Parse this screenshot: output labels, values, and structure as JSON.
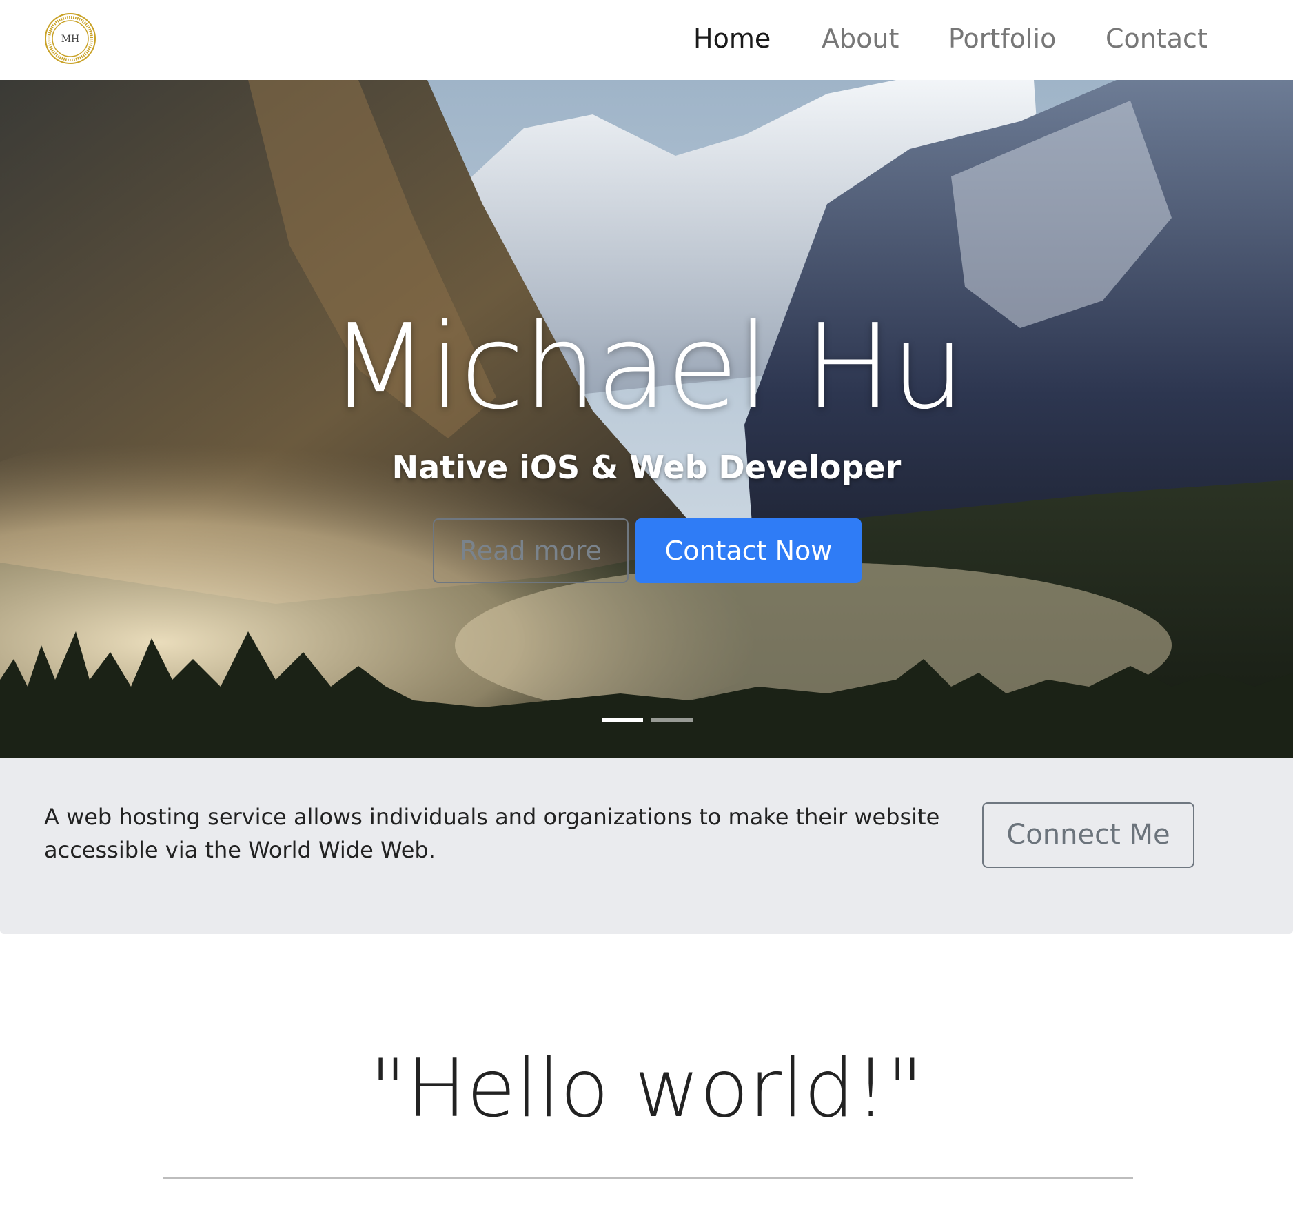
{
  "brand": {
    "logo_text": "MH",
    "logo_color": "#c9a227"
  },
  "nav": {
    "items": [
      {
        "label": "Home",
        "active": true
      },
      {
        "label": "About",
        "active": false
      },
      {
        "label": "Portfolio",
        "active": false
      },
      {
        "label": "Contact",
        "active": false
      }
    ]
  },
  "hero": {
    "title": "Michael Hu",
    "subtitle": "Native iOS & Web Developer",
    "read_more_label": "Read more",
    "contact_now_label": "Contact Now",
    "slide_count": 2,
    "active_slide": 1
  },
  "info": {
    "text": "A web hosting service allows individuals and organizations to make their website accessible via the World Wide Web.",
    "connect_label": "Connect Me"
  },
  "hello": {
    "heading": "\"Hello world!\""
  },
  "colors": {
    "primary": "#2f7cf6",
    "info_bg": "#eaebee",
    "nav_inactive": "#777777",
    "nav_active": "#1a1a1a"
  }
}
